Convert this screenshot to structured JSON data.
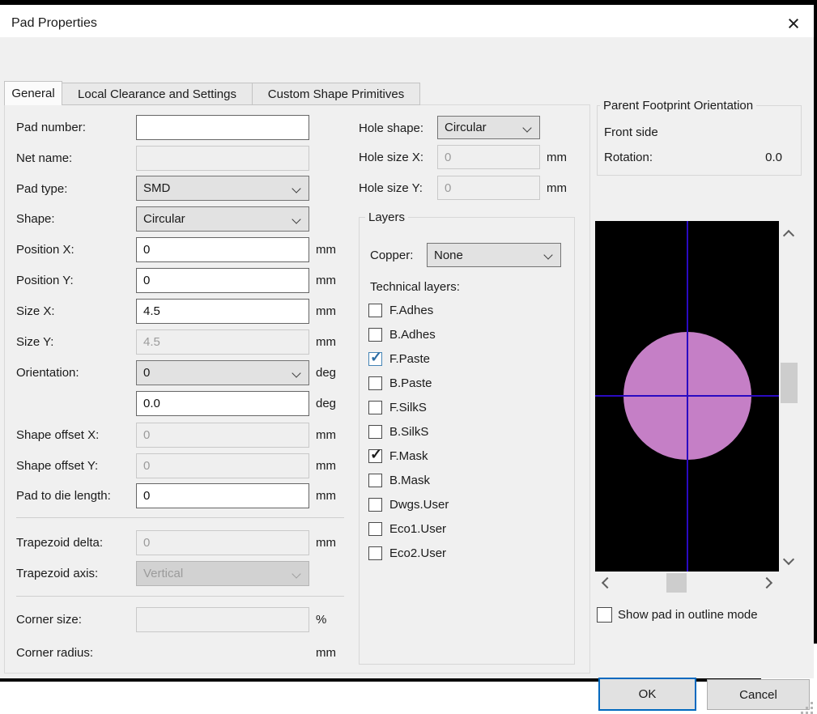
{
  "window": {
    "title": "Pad Properties"
  },
  "icons": {
    "close": "×",
    "check": "✓"
  },
  "tabs": [
    {
      "label": "General"
    },
    {
      "label": "Local Clearance and Settings"
    },
    {
      "label": "Custom Shape Primitives"
    }
  ],
  "form": {
    "pad_number": {
      "label": "Pad number:",
      "value": ""
    },
    "net_name": {
      "label": "Net name:",
      "value": ""
    },
    "pad_type": {
      "label": "Pad type:",
      "value": "SMD"
    },
    "shape": {
      "label": "Shape:",
      "value": "Circular"
    },
    "position_x": {
      "label": "Position X:",
      "value": "0",
      "unit": "mm"
    },
    "position_y": {
      "label": "Position Y:",
      "value": "0",
      "unit": "mm"
    },
    "size_x": {
      "label": "Size X:",
      "value": "4.5",
      "unit": "mm"
    },
    "size_y": {
      "label": "Size Y:",
      "value": "4.5",
      "unit": "mm"
    },
    "orientation": {
      "label": "Orientation:",
      "value": "0",
      "unit": "deg"
    },
    "orientation_aux": {
      "value": "0.0",
      "unit": "deg"
    },
    "shape_offset_x": {
      "label": "Shape offset X:",
      "value": "0",
      "unit": "mm"
    },
    "shape_offset_y": {
      "label": "Shape offset Y:",
      "value": "0",
      "unit": "mm"
    },
    "pad_to_die": {
      "label": "Pad to die length:",
      "value": "0",
      "unit": "mm"
    },
    "trapezoid_delta": {
      "label": "Trapezoid delta:",
      "value": "0",
      "unit": "mm"
    },
    "trapezoid_axis": {
      "label": "Trapezoid axis:",
      "value": "Vertical"
    },
    "corner_size": {
      "label": "Corner size:",
      "value": "",
      "unit": "%"
    },
    "corner_radius": {
      "label": "Corner radius:",
      "unit": "mm"
    }
  },
  "hole": {
    "shape": {
      "label": "Hole shape:",
      "value": "Circular"
    },
    "size_x": {
      "label": "Hole size X:",
      "value": "0",
      "unit": "mm"
    },
    "size_y": {
      "label": "Hole size Y:",
      "value": "0",
      "unit": "mm"
    }
  },
  "layers": {
    "title": "Layers",
    "copper_label": "Copper:",
    "copper_value": "None",
    "technical_label": "Technical layers:",
    "technical": [
      {
        "label": "F.Adhes",
        "checked": false
      },
      {
        "label": "B.Adhes",
        "checked": false
      },
      {
        "label": "F.Paste",
        "checked": true
      },
      {
        "label": "B.Paste",
        "checked": false
      },
      {
        "label": "F.SilkS",
        "checked": false
      },
      {
        "label": "B.SilkS",
        "checked": false
      },
      {
        "label": "F.Mask",
        "checked": true
      },
      {
        "label": "B.Mask",
        "checked": false
      },
      {
        "label": "Dwgs.User",
        "checked": false
      },
      {
        "label": "Eco1.User",
        "checked": false
      },
      {
        "label": "Eco2.User",
        "checked": false
      }
    ]
  },
  "parent": {
    "title": "Parent Footprint Orientation",
    "side": "Front side",
    "rotation_label": "Rotation:",
    "rotation_value": "0.0"
  },
  "preview": {
    "outline_label": "Show pad in outline mode",
    "canvas_bg": "#000000",
    "pad_color": "#c57fc6",
    "crosshair_color": "#2a0ac2"
  },
  "footer": {
    "ok": "OK",
    "cancel": "Cancel"
  },
  "colors": {
    "accent": "#0069bf",
    "dialog_bg": "#f0f0f0"
  }
}
